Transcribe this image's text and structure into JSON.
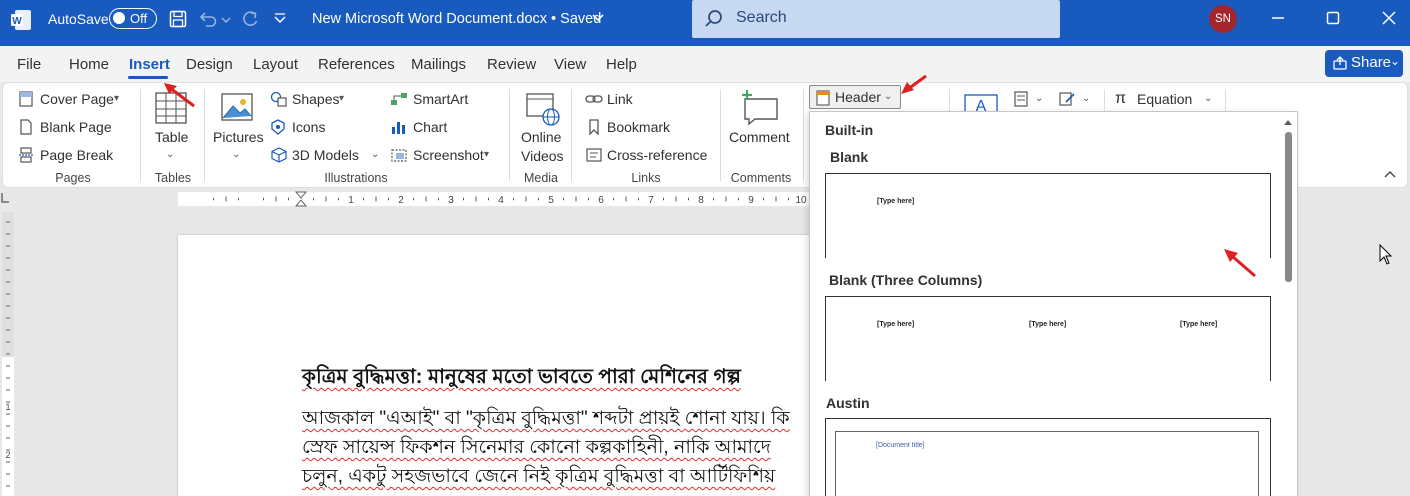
{
  "titlebar": {
    "autosave_label": "AutoSave",
    "autosave_state": "Off",
    "document_title": "New Microsoft Word Document.docx • Saved",
    "search_placeholder": "Search",
    "user_initials": "SN",
    "app_icon": "word-logo-icon",
    "bar_color": "#185abd"
  },
  "tabs": [
    {
      "label": "File"
    },
    {
      "label": "Home"
    },
    {
      "label": "Insert",
      "active": true
    },
    {
      "label": "Design"
    },
    {
      "label": "Layout"
    },
    {
      "label": "References"
    },
    {
      "label": "Mailings"
    },
    {
      "label": "Review"
    },
    {
      "label": "View"
    },
    {
      "label": "Help"
    }
  ],
  "share_label": "Share",
  "ribbon": {
    "pages": {
      "group": "Pages",
      "items": [
        "Cover Page",
        "Blank Page",
        "Page Break"
      ]
    },
    "tables": {
      "group": "Tables",
      "table": "Table"
    },
    "illustrations": {
      "group": "Illustrations",
      "pictures": "Pictures",
      "shapes": "Shapes",
      "icons": "Icons",
      "models": "3D Models",
      "smartart": "SmartArt",
      "chart": "Chart",
      "screenshot": "Screenshot"
    },
    "media": {
      "group": "Media",
      "online_videos_1": "Online",
      "online_videos_2": "Videos"
    },
    "links": {
      "group": "Links",
      "items": [
        "Link",
        "Bookmark",
        "Cross-reference"
      ]
    },
    "comments": {
      "group": "Comments",
      "comment": "Comment"
    },
    "header_button": "Header",
    "equation": "Equation"
  },
  "ruler_ticks": [
    "1",
    "2",
    "3",
    "4",
    "5",
    "6",
    "7",
    "8",
    "9",
    "10"
  ],
  "vruler_ticks": [
    "1",
    "2"
  ],
  "document": {
    "heading": "কৃত্রিম বুদ্ধিমত্তা: মানুষের মতো ভাবতে পারা মেশিনের গল্প",
    "lines": [
      "আজকাল \"এআই\" বা \"কৃত্রিম বুদ্ধিমত্তা\" শব্দটা প্রায়ই শোনা যায়। কি",
      "স্রেফ সায়েন্স ফিকশন সিনেমার কোনো কল্পকাহিনী, নাকি আমাদে",
      "চলুন, একটু সহজভাবে জেনে নিই কৃত্রিম বুদ্ধিমত্তা বা আর্টিফিশিয়"
    ]
  },
  "header_dropdown": {
    "section_label": "Built-in",
    "blank_title": "Blank",
    "blank_placeholder": "[Type here]",
    "three_col_title": "Blank (Three Columns)",
    "three_col_placeholders": [
      "[Type here]",
      "[Type here]",
      "[Type here]"
    ],
    "austin_title": "Austin",
    "austin_placeholder": "[Document title]"
  }
}
